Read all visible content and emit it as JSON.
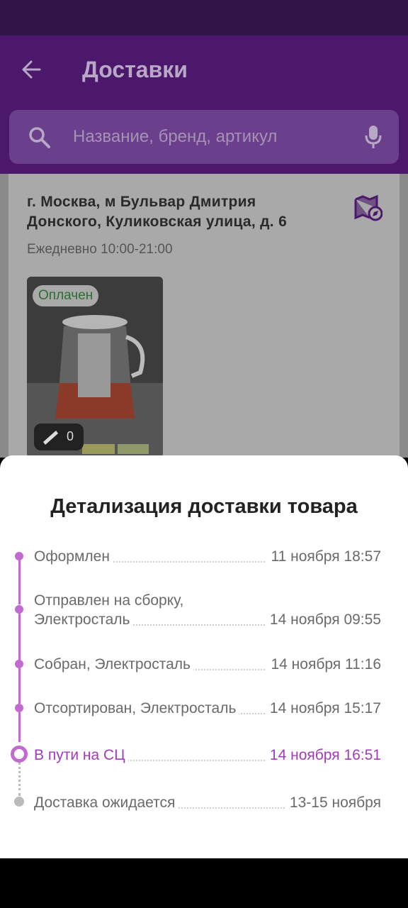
{
  "header": {
    "title": "Доставки"
  },
  "search": {
    "placeholder": "Название, бренд, артикул"
  },
  "pickup": {
    "address_line1": "г. Москва, м Бульвар Дмитрия",
    "address_line2": "Донского, Куликовская улица, д. 6",
    "hours": "Ежедневно 10:00-21:00",
    "status_badge": "Оплачен",
    "rating_count": "0"
  },
  "sheet": {
    "title": "Детализация доставки товара",
    "steps": [
      {
        "label": "Оформлен",
        "date": "11 ноября 18:57"
      },
      {
        "label_line1": "Отправлен на сборку,",
        "label": "Электросталь",
        "date": "14 ноября 09:55"
      },
      {
        "label": "Собран, Электросталь",
        "date": "14 ноября 11:16"
      },
      {
        "label": "Отсортирован, Электросталь",
        "date": "14 ноября 15:17"
      },
      {
        "label": "В пути на СЦ",
        "date": "14 ноября 16:51"
      },
      {
        "label": "Доставка ожидается",
        "date": "13-15 ноября"
      }
    ]
  },
  "colors": {
    "accent": "#c16bd0",
    "active_text": "#a03cb8",
    "appbar": "#4b186c"
  }
}
